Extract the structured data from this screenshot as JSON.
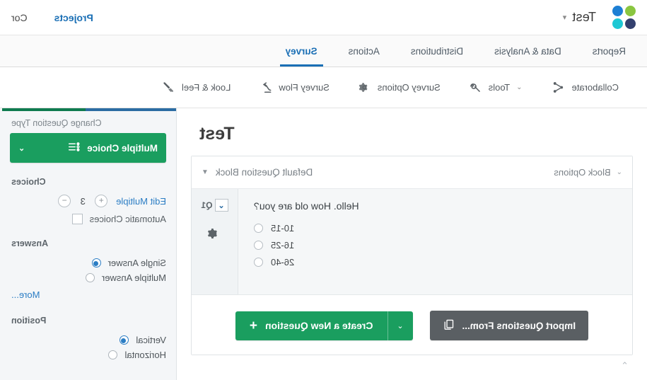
{
  "topbar": {
    "account_name": "Test",
    "account_chevron": "chevron-down",
    "nav": [
      {
        "label": "Projects",
        "active": true
      },
      {
        "label": "Cor",
        "active": false
      }
    ]
  },
  "product_nav": {
    "items": [
      {
        "label": "Survey",
        "active": true
      },
      {
        "label": "Actions",
        "active": false
      },
      {
        "label": "Distributions",
        "active": false
      },
      {
        "label": "Data & Analysis",
        "active": false
      },
      {
        "label": "Reports",
        "active": false
      }
    ],
    "active_color": "#1a6fb5"
  },
  "toolbar": {
    "items": [
      {
        "label": "Look & Feel",
        "icon": "paintbrush-icon",
        "chevron": ""
      },
      {
        "label": "Survey Flow",
        "icon": "flow-icon",
        "chevron": ""
      },
      {
        "label": "Survey Options",
        "icon": "gear-icon",
        "chevron": ""
      },
      {
        "label": "Tools",
        "icon": "wrench-icon",
        "chevron": "⌄"
      },
      {
        "label": "Collaborate",
        "icon": "share-icon",
        "chevron": ""
      }
    ]
  },
  "canvas": {
    "page_title": "Test",
    "block": {
      "name": "Default Question Block",
      "name_triangle": "▼",
      "options_label": "Block Options",
      "options_chevron": "⌄",
      "question": {
        "tag": "Q1",
        "tag_chevron": "⌄",
        "gear_icon": "gear-icon",
        "text": "Hello. How old are you?",
        "choices": [
          "10-15",
          "16-25",
          "26-40"
        ]
      },
      "footer": {
        "create_label": "Create a New Question",
        "create_plus": "+",
        "create_chevron": "⌄",
        "import_label": "Import Questions From...",
        "import_icon": "copy-icon",
        "create_color": "#1a9e5f",
        "import_color": "#5a5f63"
      }
    },
    "collapse_chevron": "⌃"
  },
  "sidebar": {
    "tab_colors": {
      "green": "#0f7b4f",
      "blue": "#2b6ca3"
    },
    "change_question_type_label": "Change Question Type",
    "question_type": {
      "label": "Multiple Choice",
      "icon": "bullet-list-icon",
      "chevron": "⌄"
    },
    "choices": {
      "label": "Choices",
      "decrease": "−",
      "count": "3",
      "increase": "+",
      "edit_multiple": "Edit Multiple",
      "automatic_label": "Automatic Choices",
      "automatic_checked": false
    },
    "answers": {
      "label": "Answers",
      "options": [
        {
          "label": "Single Answer",
          "selected": true
        },
        {
          "label": "Multiple Answer",
          "selected": false
        }
      ],
      "more": "More..."
    },
    "position": {
      "label": "Position",
      "options": [
        {
          "label": "Vertical",
          "selected": true
        },
        {
          "label": "Horizontal",
          "selected": false
        }
      ]
    }
  }
}
